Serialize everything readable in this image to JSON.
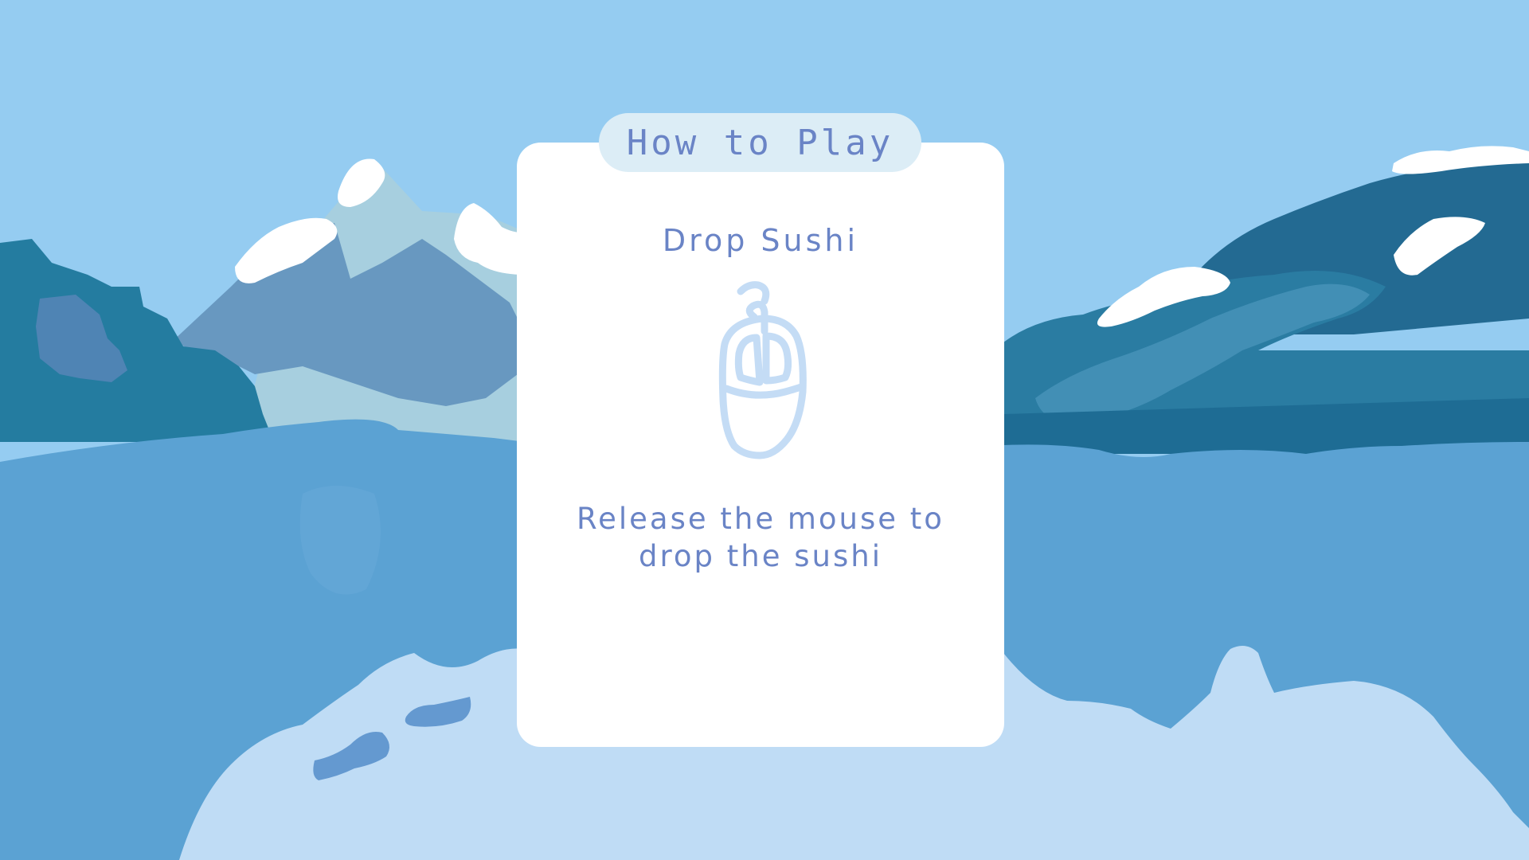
{
  "how_to_play": {
    "title": "How to Play",
    "instruction_title": "Drop Sushi",
    "icon": "mouse-icon",
    "instruction_lines": [
      "Release the mouse to",
      "drop the sushi"
    ]
  },
  "colors": {
    "sky": "#95ccf1",
    "text": "#6a84c6",
    "title_pill": "#dcedf6",
    "card": "#ffffff",
    "icon_stroke": "#c4dcf5",
    "lake": "#5ba2d3",
    "snow": "#ffffff"
  }
}
